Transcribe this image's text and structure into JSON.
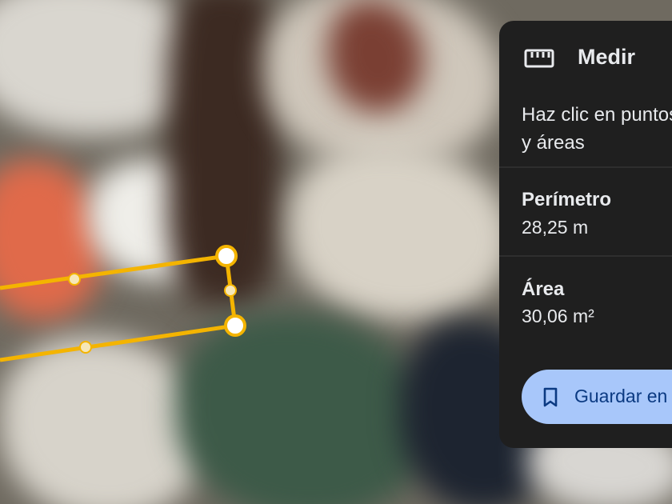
{
  "measure_panel": {
    "icon": "ruler-icon",
    "title": "Medir",
    "description_line1": "Haz clic en puntos",
    "description_line2": "y áreas",
    "perimeter_label": "Perímetro",
    "perimeter_value": "28,25 m",
    "area_label": "Área",
    "area_value": "30,06 m²",
    "save_icon": "bookmark-icon",
    "save_label": "Guardar en"
  },
  "colors": {
    "panel_bg": "#1f1f1f",
    "accent_button": "#a8c7fa",
    "measure_line": "#f4b400"
  }
}
